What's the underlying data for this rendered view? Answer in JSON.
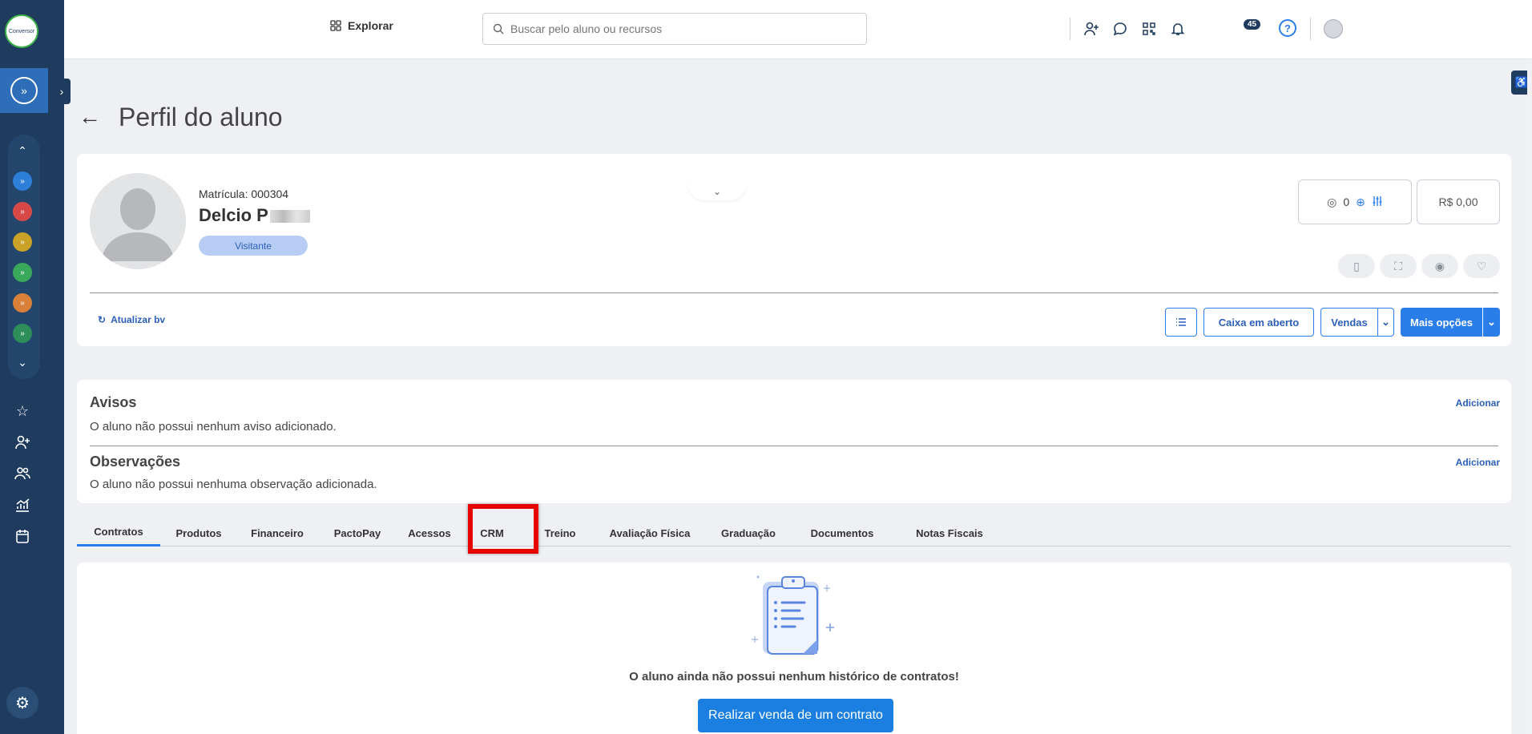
{
  "sidebar": {
    "logo_text": "Conversor",
    "unit_colors": [
      "#2e7fd9",
      "#d94848",
      "#c9a227",
      "#38a95b",
      "#d9813a",
      "#2f8f5b"
    ],
    "icons": [
      "star-icon",
      "add-person-icon",
      "people-icon",
      "chart-icon",
      "calendar-icon"
    ]
  },
  "topbar": {
    "explorar_label": "Explorar",
    "search_placeholder": "Buscar pelo aluno ou recursos",
    "notification_count": "45",
    "help_label": "?"
  },
  "page": {
    "title": "Perfil do aluno"
  },
  "profile": {
    "matricula": "Matrícula: 000304",
    "name": "Delcio P",
    "status_badge": "Visitante",
    "points_value": "0",
    "balance": "R$ 0,00",
    "refresh_label": "Atualizar bv",
    "actions": {
      "caixa": "Caixa em aberto",
      "vendas": "Vendas",
      "mais": "Mais opções"
    }
  },
  "notes": {
    "avisos_title": "Avisos",
    "avisos_text": "O aluno não possui nenhum aviso adicionado.",
    "observacoes_title": "Observações",
    "observacoes_text": "O aluno não possui nenhuma observação adicionada.",
    "add_label": "Adicionar"
  },
  "tabs": [
    {
      "label": "Contratos"
    },
    {
      "label": "Produtos"
    },
    {
      "label": "Financeiro"
    },
    {
      "label": "PactoPay"
    },
    {
      "label": "Acessos"
    },
    {
      "label": "CRM"
    },
    {
      "label": "Treino"
    },
    {
      "label": "Avaliação Física"
    },
    {
      "label": "Graduação"
    },
    {
      "label": "Documentos"
    },
    {
      "label": "Notas Fiscais"
    }
  ],
  "content": {
    "empty_message": "O aluno ainda não possui nenhum histórico de contratos!",
    "cta_label": "Realizar venda de um contrato"
  },
  "colors": {
    "sidebar": "#1f3c5e",
    "accent": "#2b7de9",
    "highlight": "#e60000"
  }
}
